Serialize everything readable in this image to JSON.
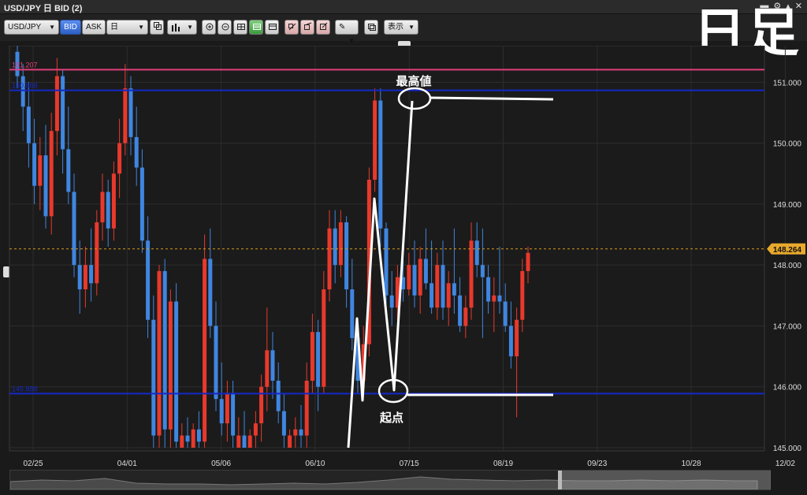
{
  "window": {
    "title": "USD/JPY 日 BID (2)"
  },
  "toolbar": {
    "symbol": "USD/JPY",
    "bid_label": "BID",
    "ask_label": "ASK",
    "timeframe": "日",
    "display_label": "表示"
  },
  "overlay_label": "日足",
  "chart_data": {
    "type": "candlestick",
    "ylim": [
      145.0,
      151.6
    ],
    "y_ticks": [
      "151.000",
      "150.000",
      "149.000",
      "148.000",
      "147.000",
      "146.000",
      "145.000"
    ],
    "x_ticks": [
      "02/25",
      "04/01",
      "05/06",
      "06/10",
      "07/15",
      "08/19",
      "09/23",
      "10/28",
      "12/02"
    ],
    "current_price": "148.264",
    "horizontal_lines": [
      {
        "label": "151.207",
        "value": 151.207,
        "color": "#e0407a"
      },
      {
        "label": "150.868",
        "value": 150.868,
        "color": "#1428c8"
      },
      {
        "label": "145.888",
        "value": 145.888,
        "color": "#1428c8"
      }
    ],
    "annotations": {
      "high_label": "最高値",
      "start_label": "起点"
    },
    "candles": [
      [
        151.5,
        151.6,
        150.9,
        151.1
      ],
      [
        151.1,
        151.3,
        150.2,
        150.6
      ],
      [
        150.6,
        151.0,
        149.6,
        150.0
      ],
      [
        150.0,
        150.4,
        149.0,
        149.3
      ],
      [
        149.3,
        150.1,
        148.9,
        149.8
      ],
      [
        149.8,
        150.3,
        148.6,
        148.8
      ],
      [
        148.8,
        150.5,
        148.5,
        150.2
      ],
      [
        150.2,
        151.4,
        149.8,
        151.1
      ],
      [
        151.1,
        151.2,
        149.5,
        149.9
      ],
      [
        149.9,
        150.6,
        149.0,
        149.2
      ],
      [
        149.2,
        149.5,
        147.8,
        148.0
      ],
      [
        148.0,
        148.4,
        147.2,
        147.6
      ],
      [
        147.6,
        148.3,
        147.3,
        148.0
      ],
      [
        148.0,
        148.6,
        147.4,
        147.7
      ],
      [
        147.7,
        148.9,
        147.5,
        148.7
      ],
      [
        148.7,
        149.5,
        148.4,
        149.2
      ],
      [
        149.2,
        149.4,
        148.3,
        148.6
      ],
      [
        148.6,
        149.7,
        148.4,
        149.5
      ],
      [
        149.5,
        150.4,
        149.1,
        150.0
      ],
      [
        150.0,
        151.3,
        149.8,
        150.9
      ],
      [
        150.9,
        151.1,
        149.8,
        150.1
      ],
      [
        150.1,
        150.6,
        149.3,
        149.6
      ],
      [
        149.6,
        149.9,
        148.2,
        148.4
      ],
      [
        148.4,
        148.8,
        146.8,
        147.1
      ],
      [
        147.1,
        147.5,
        145.0,
        145.2
      ],
      [
        145.2,
        148.0,
        145.0,
        147.9
      ],
      [
        147.9,
        148.1,
        145.0,
        145.3
      ],
      [
        145.3,
        147.6,
        145.0,
        147.4
      ],
      [
        147.4,
        147.7,
        145.0,
        145.1
      ],
      [
        145.0,
        145.4,
        145.0,
        145.2
      ],
      [
        145.2,
        145.5,
        145.0,
        145.1
      ],
      [
        145.0,
        145.4,
        145.0,
        145.3
      ],
      [
        145.3,
        145.6,
        145.0,
        145.1
      ],
      [
        145.1,
        148.5,
        145.0,
        148.1
      ],
      [
        148.1,
        148.6,
        146.8,
        147.0
      ],
      [
        147.0,
        147.4,
        145.6,
        145.8
      ],
      [
        145.8,
        146.4,
        145.2,
        145.4
      ],
      [
        145.4,
        146.1,
        145.1,
        145.9
      ],
      [
        145.9,
        146.1,
        145.0,
        145.2
      ],
      [
        145.0,
        145.5,
        145.0,
        145.2
      ],
      [
        145.2,
        145.6,
        145.0,
        145.0
      ],
      [
        145.0,
        145.3,
        145.0,
        145.2
      ],
      [
        145.2,
        145.6,
        145.0,
        145.4
      ],
      [
        145.4,
        146.2,
        145.1,
        146.0
      ],
      [
        146.0,
        147.3,
        145.6,
        146.6
      ],
      [
        146.6,
        146.9,
        145.8,
        146.1
      ],
      [
        146.1,
        146.4,
        145.4,
        145.6
      ],
      [
        145.6,
        145.9,
        145.0,
        145.2
      ],
      [
        145.0,
        145.3,
        145.0,
        145.2
      ],
      [
        145.2,
        145.5,
        145.0,
        145.3
      ],
      [
        145.3,
        145.7,
        145.0,
        145.2
      ],
      [
        145.2,
        146.4,
        145.0,
        146.1
      ],
      [
        146.1,
        147.2,
        145.9,
        146.9
      ],
      [
        146.9,
        147.1,
        145.6,
        146.0
      ],
      [
        146.0,
        147.9,
        145.9,
        147.6
      ],
      [
        147.6,
        148.9,
        147.4,
        148.6
      ],
      [
        148.6,
        148.9,
        147.7,
        148.0
      ],
      [
        148.0,
        148.9,
        147.8,
        148.7
      ],
      [
        148.7,
        148.8,
        147.3,
        147.6
      ],
      [
        147.6,
        148.1,
        146.6,
        146.8
      ],
      [
        146.8,
        147.1,
        145.9,
        146.1
      ],
      [
        146.1,
        147.0,
        145.9,
        146.7
      ],
      [
        146.7,
        149.6,
        146.5,
        149.4
      ],
      [
        149.4,
        150.9,
        149.2,
        150.7
      ],
      [
        150.7,
        150.9,
        148.3,
        148.6
      ],
      [
        148.6,
        148.7,
        147.3,
        147.5
      ],
      [
        147.5,
        147.9,
        147.0,
        147.3
      ],
      [
        147.3,
        148.0,
        147.1,
        147.8
      ],
      [
        147.8,
        148.3,
        147.4,
        147.6
      ],
      [
        147.6,
        148.2,
        147.5,
        148.0
      ],
      [
        148.0,
        148.4,
        147.3,
        147.5
      ],
      [
        147.5,
        148.3,
        147.2,
        148.1
      ],
      [
        148.1,
        148.6,
        147.6,
        147.7
      ],
      [
        147.7,
        148.4,
        147.2,
        147.3
      ],
      [
        147.3,
        148.2,
        147.1,
        148.0
      ],
      [
        148.0,
        148.4,
        147.1,
        147.3
      ],
      [
        147.3,
        147.9,
        147.0,
        147.7
      ],
      [
        147.7,
        148.6,
        147.2,
        147.5
      ],
      [
        147.5,
        147.8,
        146.9,
        147.0
      ],
      [
        147.0,
        147.5,
        146.8,
        147.3
      ],
      [
        147.3,
        148.7,
        147.1,
        148.4
      ],
      [
        148.4,
        148.7,
        147.8,
        148.0
      ],
      [
        148.0,
        148.6,
        146.8,
        147.8
      ],
      [
        147.8,
        148.0,
        147.2,
        147.4
      ],
      [
        147.4,
        147.8,
        146.9,
        147.5
      ],
      [
        147.5,
        148.3,
        147.2,
        147.4
      ],
      [
        147.4,
        147.7,
        146.9,
        147.0
      ],
      [
        147.0,
        147.4,
        146.3,
        146.5
      ],
      [
        146.5,
        147.3,
        145.5,
        147.1
      ],
      [
        147.1,
        148.1,
        146.9,
        147.9
      ],
      [
        147.9,
        148.3,
        147.7,
        148.2
      ]
    ]
  }
}
